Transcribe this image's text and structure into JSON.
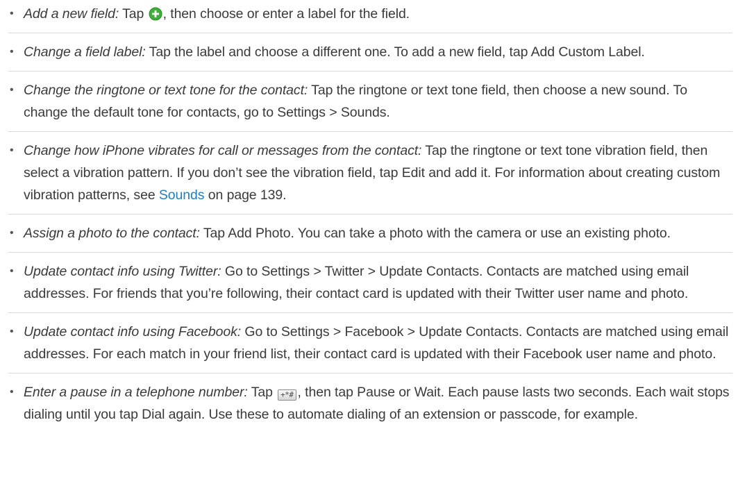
{
  "items": [
    {
      "term": "Add a new field:",
      "text_before": "Tap",
      "text_after": ", then choose or enter a label for the field."
    },
    {
      "term": "Change a field label:",
      "text": "Tap the label and choose a different one. To add a new field, tap Add Custom Label."
    },
    {
      "term": "Change the ringtone or text tone for the contact:",
      "text": "Tap the ringtone or text tone field, then choose a new sound. To change the default tone for contacts, go to Settings > Sounds."
    },
    {
      "term": "Change how iPhone vibrates for call or messages from the contact:",
      "text_before": "Tap the ringtone or text tone vibration field, then select a vibration pattern. If you don’t see the vibration field, tap Edit and add it. For information about creating custom vibration patterns, see",
      "link": "Sounds",
      "text_after": "on page 139."
    },
    {
      "term": "Assign a photo to the contact:",
      "text": "Tap Add Photo. You can take a photo with the camera or use an existing photo."
    },
    {
      "term": "Update contact info using Twitter:",
      "text": "Go to Settings > Twitter > Update Contacts. Contacts are matched using email addresses. For friends that you’re following, their contact card is updated with their Twitter user name and photo."
    },
    {
      "term": "Update contact info using Facebook:",
      "text": "Go to Settings > Facebook > Update Contacts. Contacts are matched using email addresses. For each match in your friend list, their contact card is updated with their Facebook user name and photo."
    },
    {
      "term": "Enter a pause in a telephone number:",
      "text_before": "Tap",
      "icon_label": "+*#",
      "text_after": ", then tap Pause or Wait. Each pause lasts two seconds. Each wait stops dialing until you tap Dial again. Use these to automate dialing of an extension or passcode, for example."
    }
  ],
  "bullet": "•",
  "icons": {
    "add": "add-circle-icon",
    "keypad": "keypad-symbols-icon"
  },
  "colors": {
    "text": "#3a3a3a",
    "link": "#1f7ec4",
    "add_icon": "#3fae3a",
    "divider": "#d9d9d9"
  }
}
